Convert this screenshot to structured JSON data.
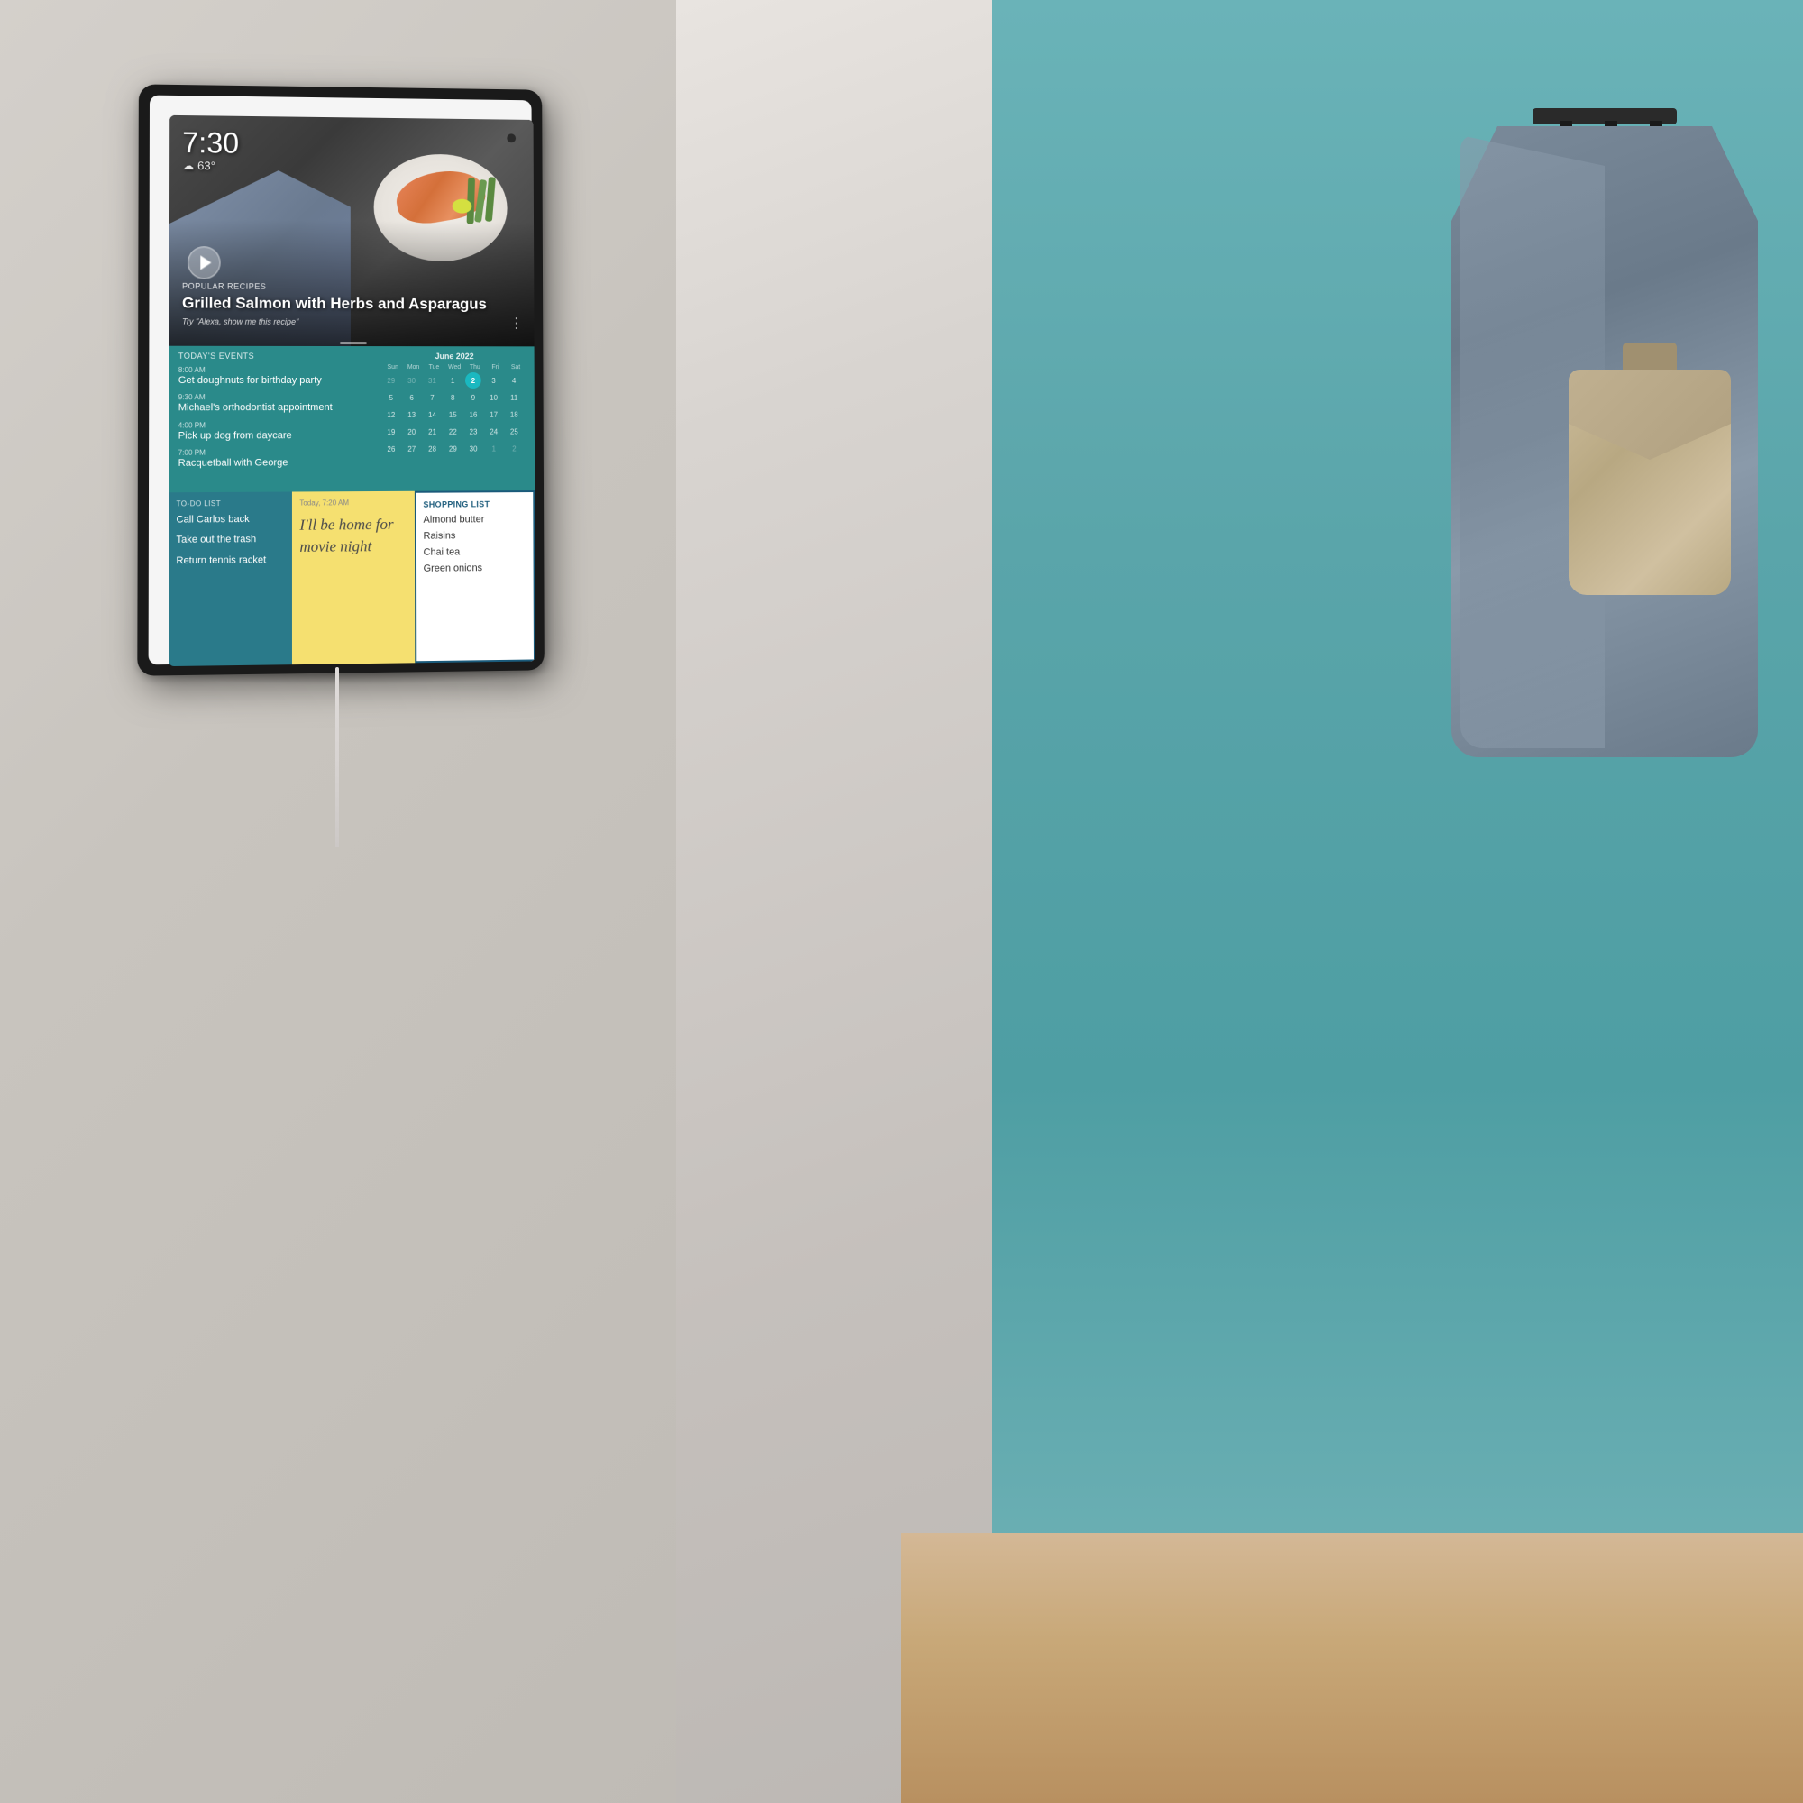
{
  "wall": {
    "left_color": "#c8c4be",
    "right_color": "#d8d4d0"
  },
  "device": {
    "frame_color": "#1a1a1a"
  },
  "screen": {
    "time": "7:30",
    "weather": "63°",
    "weather_icon": "cloud-sun-icon",
    "hero": {
      "category": "Popular Recipes",
      "title": "Grilled Salmon with Herbs and Asparagus",
      "hint": "Try \"Alexa, show me this recipe\""
    },
    "events": {
      "header": "Today's Events",
      "calendar_month": "June 2022",
      "calendar_days_labels": [
        "Sun",
        "Mon",
        "Tue",
        "Wed",
        "Thu",
        "Fri",
        "Sat"
      ],
      "calendar_weeks": [
        [
          "29",
          "30",
          "31",
          "1",
          "2",
          "3",
          "4"
        ],
        [
          "5",
          "6",
          "7",
          "8",
          "9",
          "10",
          "11"
        ],
        [
          "12",
          "13",
          "14",
          "15",
          "16",
          "17",
          "18"
        ],
        [
          "19",
          "20",
          "21",
          "22",
          "23",
          "24",
          "25"
        ],
        [
          "26",
          "27",
          "28",
          "29",
          "30",
          "1",
          "2"
        ]
      ],
      "today_date": "2",
      "items": [
        {
          "time": "8:00 AM",
          "title": "Get doughnuts for birthday party"
        },
        {
          "time": "9:30 AM",
          "title": "Michael's orthodontist appointment"
        },
        {
          "time": "4:00 PM",
          "title": "Pick up dog from daycare"
        },
        {
          "time": "7:00 PM",
          "title": "Racquetball with George"
        }
      ]
    },
    "todo": {
      "label": "To-Do List",
      "items": [
        "Call Carlos back",
        "Take out the trash",
        "Return tennis racket"
      ]
    },
    "note": {
      "timestamp": "Today, 7:20 AM",
      "text": "I'll be home for movie night"
    },
    "shopping": {
      "label": "Shopping List",
      "items": [
        "Almond butter",
        "Raisins",
        "Chai tea",
        "Green onions"
      ]
    }
  }
}
